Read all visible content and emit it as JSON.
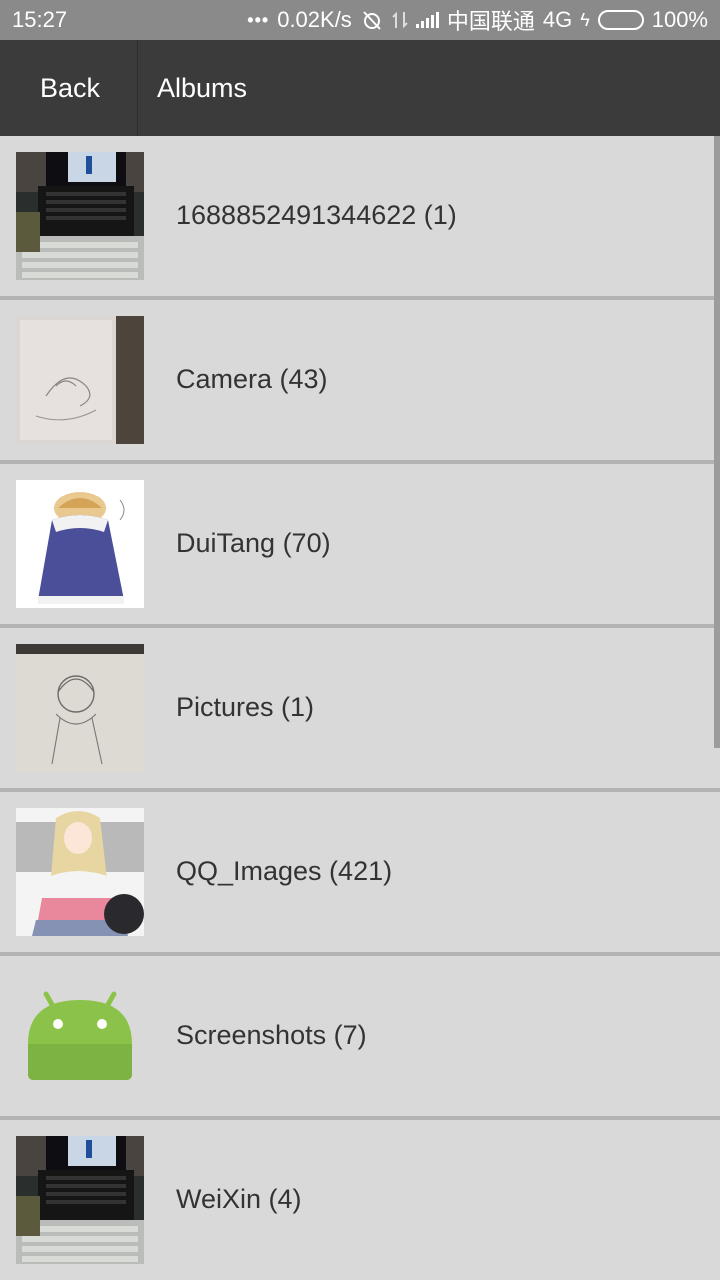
{
  "status_bar": {
    "time": "15:27",
    "dots": "•••",
    "net_speed": "0.02K/s",
    "carrier": "中国联通",
    "network_type": "4G",
    "battery_percent": "100%",
    "battery_color": "#5bd02a"
  },
  "app_bar": {
    "back_label": "Back",
    "title": "Albums"
  },
  "albums": [
    {
      "label": "1688852491344622 (1)",
      "thumbnail": "laptop-photo"
    },
    {
      "label": "Camera (43)",
      "thumbnail": "sketch-paper-photo"
    },
    {
      "label": "DuiTang (70)",
      "thumbnail": "anime-blue-cloak"
    },
    {
      "label": "Pictures (1)",
      "thumbnail": "pencil-sketch-girl"
    },
    {
      "label": "QQ_Images (421)",
      "thumbnail": "anime-blonde-girl"
    },
    {
      "label": "Screenshots (7)",
      "thumbnail": "android-icon"
    },
    {
      "label": "WeiXin (4)",
      "thumbnail": "laptop-photo"
    }
  ]
}
